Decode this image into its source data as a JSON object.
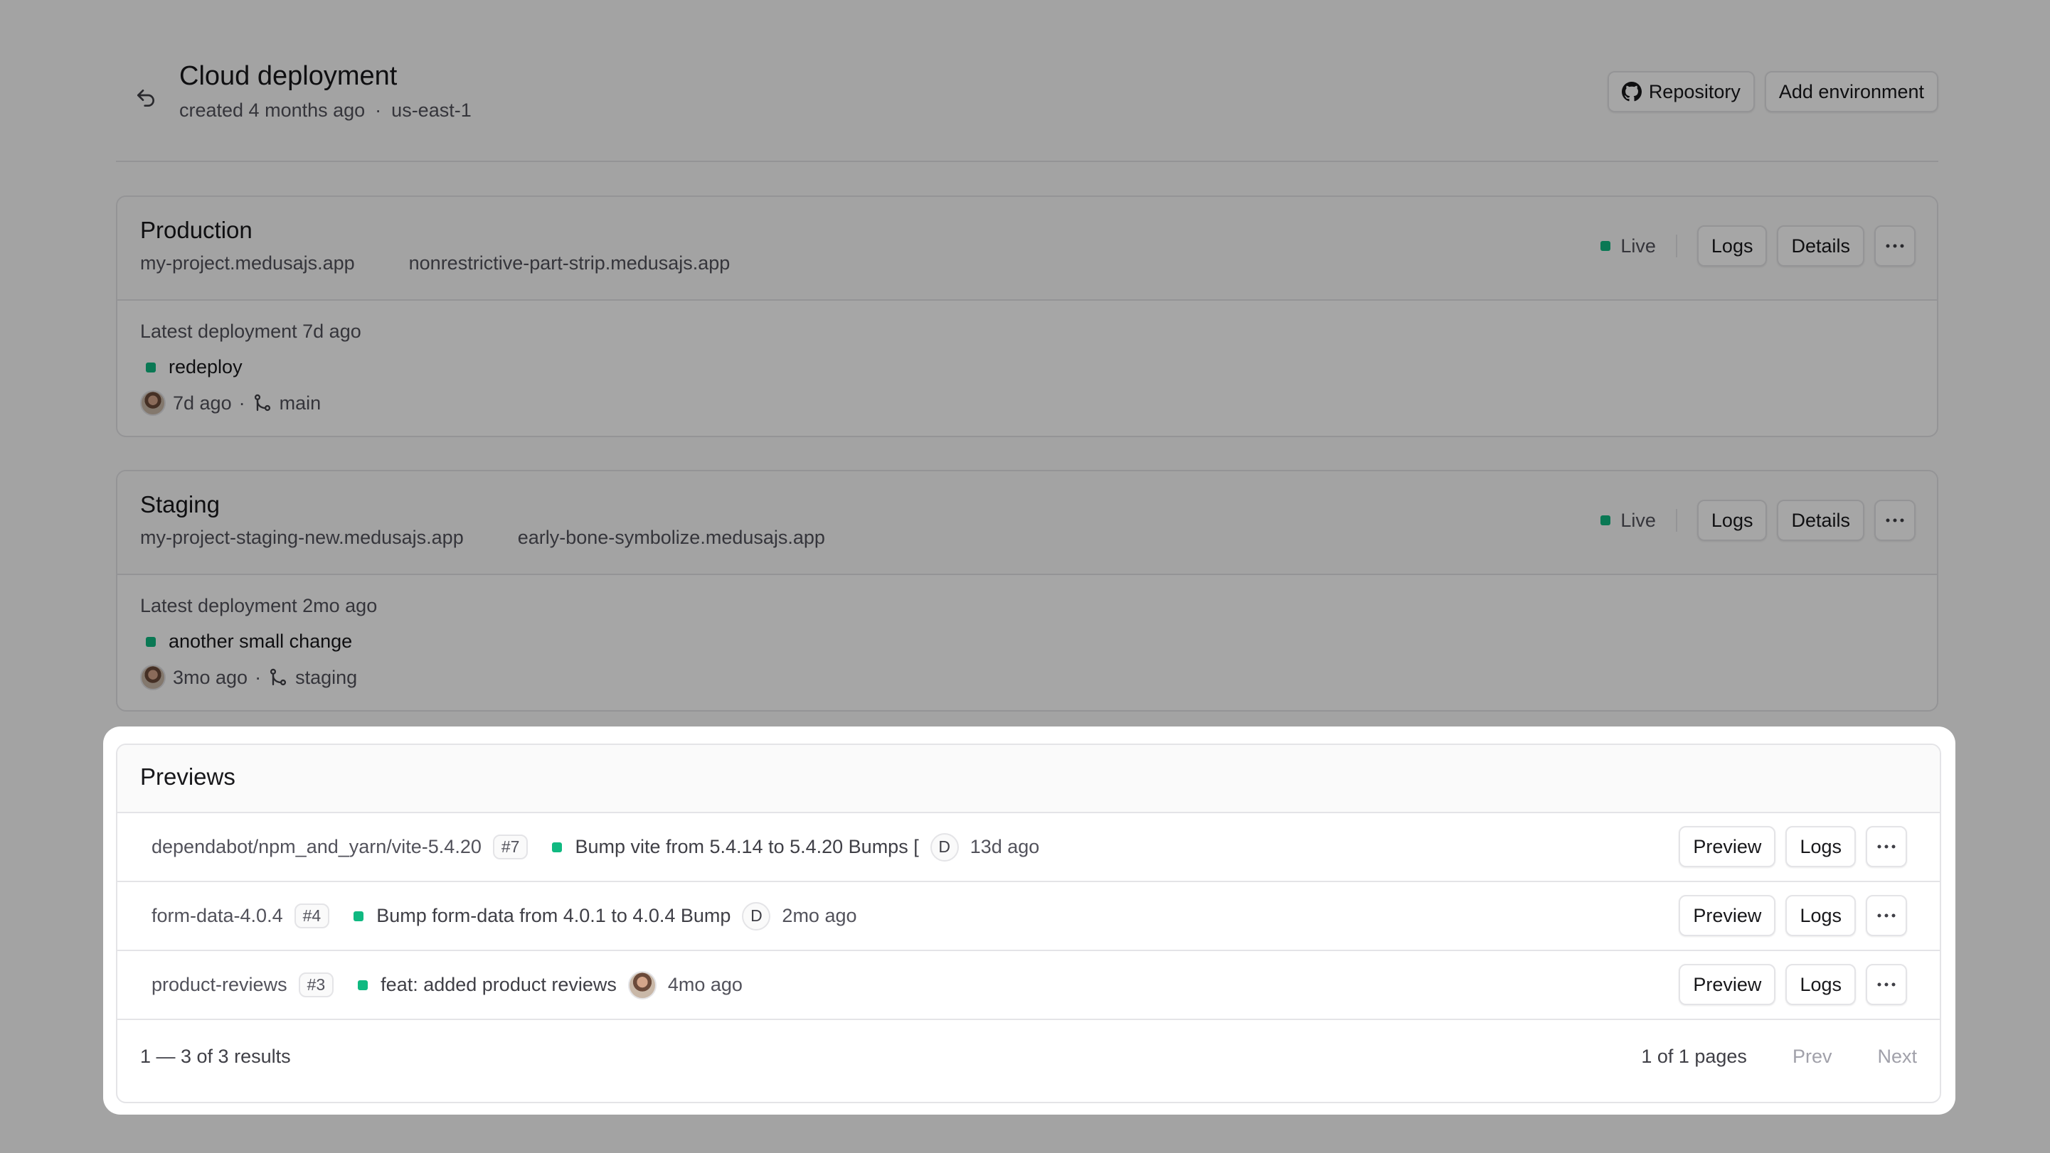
{
  "header": {
    "title": "Cloud deployment",
    "created": "created 4 months ago",
    "separator": "·",
    "region": "us-east-1",
    "repository_label": "Repository",
    "add_environment_label": "Add environment"
  },
  "environments": [
    {
      "name": "Production",
      "domains": [
        "my-project.medusajs.app",
        "nonrestrictive-part-strip.medusajs.app"
      ],
      "status": "Live",
      "logs_label": "Logs",
      "details_label": "Details",
      "latest": "Latest deployment 7d ago",
      "commit": "redeploy",
      "time": "7d ago",
      "dot": "·",
      "branch": "main"
    },
    {
      "name": "Staging",
      "domains": [
        "my-project-staging-new.medusajs.app",
        "early-bone-symbolize.medusajs.app"
      ],
      "status": "Live",
      "logs_label": "Logs",
      "details_label": "Details",
      "latest": "Latest deployment 2mo ago",
      "commit": "another small change",
      "time": "3mo ago",
      "dot": "·",
      "branch": "staging"
    }
  ],
  "previews": {
    "title": "Previews",
    "rows": [
      {
        "branch": "dependabot/npm_and_yarn/vite-5.4.20",
        "pr": "#7",
        "message": "Bump vite from 5.4.14 to 5.4.20 Bumps [",
        "author": "D",
        "time": "13d ago",
        "preview_label": "Preview",
        "logs_label": "Logs"
      },
      {
        "branch": "form-data-4.0.4",
        "pr": "#4",
        "message": "Bump form-data from 4.0.1 to 4.0.4 Bump",
        "author": "D",
        "time": "2mo ago",
        "preview_label": "Preview",
        "logs_label": "Logs"
      },
      {
        "branch": "product-reviews",
        "pr": "#3",
        "message": "feat: added product reviews",
        "author": "",
        "time": "4mo ago",
        "preview_label": "Preview",
        "logs_label": "Logs"
      }
    ],
    "results": "1 — 3 of 3 results",
    "pages": "1 of 1 pages",
    "prev_label": "Prev",
    "next_label": "Next"
  },
  "colors": {
    "live": "#10b981",
    "border": "#e4e4e7",
    "text": "#18181b",
    "muted": "#52525b"
  },
  "icons": {
    "back": "undo-arrow-icon",
    "repository": "github-icon",
    "more": "ellipsis-icon",
    "branch": "git-branch-icon"
  }
}
